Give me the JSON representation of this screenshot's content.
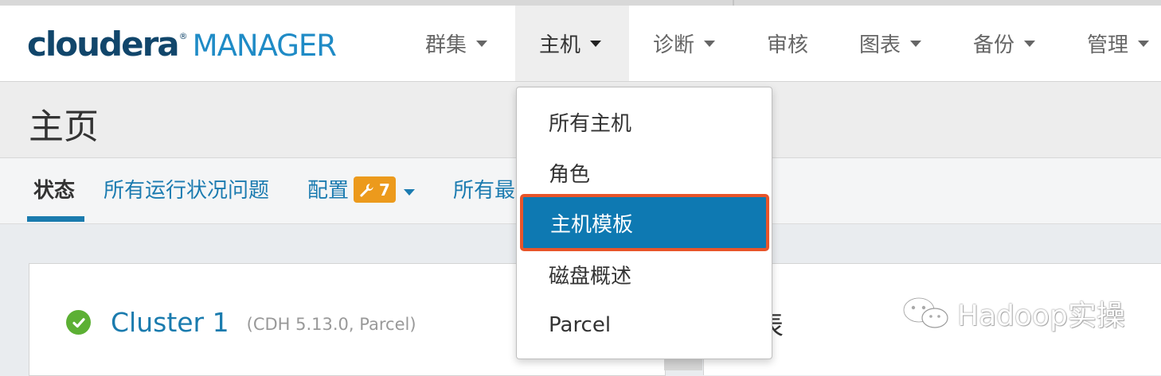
{
  "logo": {
    "brand": "cloudera",
    "reg": "®",
    "product": "MANAGER"
  },
  "nav": {
    "items": [
      {
        "label": "群集",
        "has_caret": true
      },
      {
        "label": "主机",
        "has_caret": true,
        "active": true
      },
      {
        "label": "诊断",
        "has_caret": true
      },
      {
        "label": "审核",
        "has_caret": false
      },
      {
        "label": "图表",
        "has_caret": true
      },
      {
        "label": "备份",
        "has_caret": true
      },
      {
        "label": "管理",
        "has_caret": true
      }
    ]
  },
  "page": {
    "title": "主页"
  },
  "tabs": {
    "status": "状态",
    "health_issues": "所有运行状况问题",
    "config": "配置",
    "config_badge_count": "7",
    "recent": "所有最"
  },
  "cluster": {
    "name": "Cluster 1",
    "meta": "(CDH 5.13.0, Parcel)",
    "status_color": "#5cb034"
  },
  "right_panel": {
    "title_fragment": "表"
  },
  "hosts_menu": {
    "items": [
      {
        "label": "所有主机"
      },
      {
        "label": "角色"
      },
      {
        "label": "主机模板",
        "highlighted": true
      },
      {
        "label": "磁盘概述"
      },
      {
        "label": "Parcel"
      }
    ]
  },
  "watermark": {
    "text": "Hadoop实操"
  },
  "colors": {
    "accent": "#0e79b2",
    "link": "#1b7bb0",
    "badge": "#ec9a1c",
    "highlight_border": "#e8552a",
    "logo_dark": "#11466b",
    "logo_light": "#1f8bc6"
  }
}
